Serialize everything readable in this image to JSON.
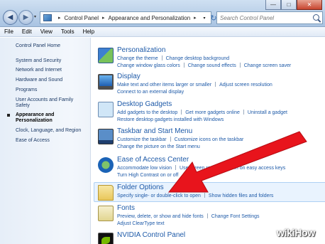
{
  "window": {
    "minimize_glyph": "—",
    "maximize_glyph": "□",
    "close_glyph": "✕"
  },
  "nav": {
    "back_glyph": "◀",
    "forward_glyph": "▶",
    "dropdown_glyph": "▾",
    "refresh_glyph": "↻"
  },
  "address": {
    "crumbs": [
      "Control Panel",
      "Appearance and Personalization"
    ],
    "separator": "▸",
    "dropdown_glyph": "▾"
  },
  "search": {
    "placeholder": "Search Control Panel"
  },
  "menu": [
    "File",
    "Edit",
    "View",
    "Tools",
    "Help"
  ],
  "sidebar": {
    "home": "Control Panel Home",
    "items": [
      "System and Security",
      "Network and Internet",
      "Hardware and Sound",
      "Programs",
      "User Accounts and Family Safety",
      "Appearance and Personalization",
      "Clock, Language, and Region",
      "Ease of Access"
    ],
    "active_index": 5
  },
  "categories": [
    {
      "title": "Personalization",
      "icon": "personalization-icon",
      "link_rows": [
        [
          "Change the theme",
          "Change desktop background"
        ],
        [
          "Change window glass colors",
          "Change sound effects",
          "Change screen saver"
        ]
      ]
    },
    {
      "title": "Display",
      "icon": "display-icon",
      "link_rows": [
        [
          "Make text and other items larger or smaller",
          "Adjust screen resolution"
        ],
        [
          "Connect to an external display"
        ]
      ]
    },
    {
      "title": "Desktop Gadgets",
      "icon": "gadgets-icon",
      "link_rows": [
        [
          "Add gadgets to the desktop",
          "Get more gadgets online",
          "Uninstall a gadget"
        ],
        [
          "Restore desktop gadgets installed with Windows"
        ]
      ]
    },
    {
      "title": "Taskbar and Start Menu",
      "icon": "taskbar-icon",
      "link_rows": [
        [
          "Customize the taskbar",
          "Customize icons on the taskbar"
        ],
        [
          "Change the picture on the Start menu"
        ]
      ]
    },
    {
      "title": "Ease of Access Center",
      "icon": "ease-of-access-icon",
      "link_rows": [
        [
          "Accommodate low vision",
          "Use screen reader",
          "Turn on easy access keys"
        ],
        [
          "Turn High Contrast on or off"
        ]
      ]
    },
    {
      "title": "Folder Options",
      "icon": "folder-options-icon",
      "highlighted": true,
      "link_rows": [
        [
          "Specify single- or double-click to open",
          "Show hidden files and folders"
        ]
      ]
    },
    {
      "title": "Fonts",
      "icon": "fonts-icon",
      "link_rows": [
        [
          "Preview, delete, or show and hide fonts",
          "Change Font Settings"
        ],
        [
          "Adjust ClearType text"
        ]
      ]
    },
    {
      "title": "NVIDIA Control Panel",
      "icon": "nvidia-icon",
      "link_rows": []
    }
  ],
  "annotation": {
    "arrow_color": "#e8141c"
  },
  "watermark": {
    "prefix": "wiki",
    "suffix": "How"
  }
}
